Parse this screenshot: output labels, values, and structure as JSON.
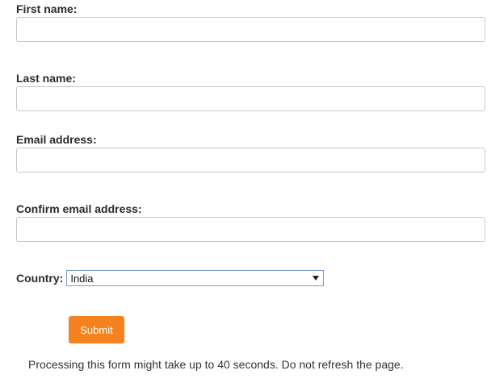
{
  "form": {
    "first_name": {
      "label": "First name:",
      "value": ""
    },
    "last_name": {
      "label": "Last name:",
      "value": ""
    },
    "email": {
      "label": "Email address:",
      "value": ""
    },
    "confirm_email": {
      "label": "Confirm email address:",
      "value": ""
    },
    "country": {
      "label": "Country:",
      "selected": "India"
    },
    "submit_label": "Submit",
    "note": "Processing this form might take up to 40 seconds. Do not refresh the page."
  },
  "colors": {
    "submit_bg": "#f5811f",
    "input_border": "#c8c8c8",
    "select_border": "#7a9cc6"
  }
}
